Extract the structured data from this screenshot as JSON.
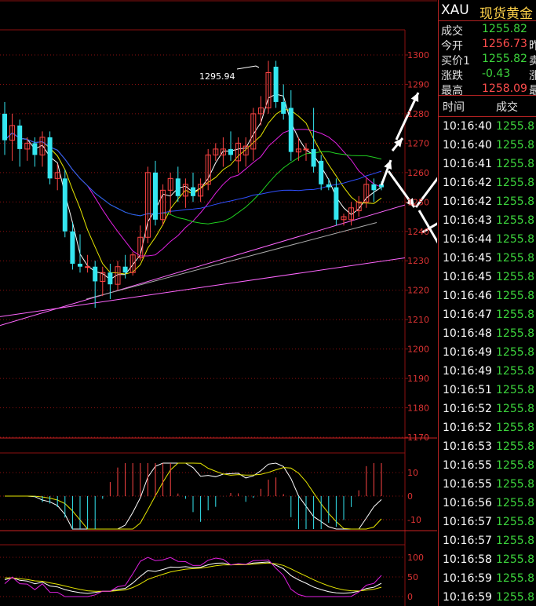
{
  "chart": {
    "peak_label": "1295.94",
    "price_axis": [
      "1300",
      "1290",
      "1280",
      "1270",
      "1260",
      "1250",
      "1240",
      "1230",
      "1220",
      "1210",
      "1200",
      "1190",
      "1180",
      "1170"
    ],
    "macd_axis": [
      "10",
      "0",
      "-10"
    ],
    "kdj_axis": [
      "100",
      "50",
      "0"
    ],
    "colors": {
      "up": "#ff4444",
      "down": "#34e6f0",
      "ma_white": "#ffffff",
      "ma_yellow": "#e6e600",
      "ma_magenta": "#e020e0",
      "ma_green": "#20d020",
      "ma_blue": "#3050ff",
      "trend": "#ff66ff",
      "grid": "#8b1010"
    }
  },
  "chart_data": {
    "type": "candlestick",
    "ylim": [
      1170,
      1305
    ],
    "candles": [
      {
        "o": 1280,
        "h": 1284,
        "l": 1266,
        "c": 1271
      },
      {
        "o": 1271,
        "h": 1280,
        "l": 1264,
        "c": 1276
      },
      {
        "o": 1276,
        "h": 1278,
        "l": 1262,
        "c": 1268
      },
      {
        "o": 1268,
        "h": 1272,
        "l": 1264,
        "c": 1270
      },
      {
        "o": 1270,
        "h": 1272,
        "l": 1262,
        "c": 1266
      },
      {
        "o": 1266,
        "h": 1274,
        "l": 1262,
        "c": 1272
      },
      {
        "o": 1272,
        "h": 1274,
        "l": 1256,
        "c": 1258
      },
      {
        "o": 1258,
        "h": 1263,
        "l": 1254,
        "c": 1260
      },
      {
        "o": 1258,
        "h": 1261,
        "l": 1238,
        "c": 1240
      },
      {
        "o": 1240,
        "h": 1243,
        "l": 1227,
        "c": 1229
      },
      {
        "o": 1229,
        "h": 1239,
        "l": 1226,
        "c": 1228
      },
      {
        "o": 1228,
        "h": 1232,
        "l": 1226,
        "c": 1228
      },
      {
        "o": 1228,
        "h": 1230,
        "l": 1214,
        "c": 1223
      },
      {
        "o": 1223,
        "h": 1228,
        "l": 1218,
        "c": 1226
      },
      {
        "o": 1226,
        "h": 1229,
        "l": 1217,
        "c": 1222
      },
      {
        "o": 1222,
        "h": 1230,
        "l": 1220,
        "c": 1228
      },
      {
        "o": 1228,
        "h": 1232,
        "l": 1224,
        "c": 1226
      },
      {
        "o": 1226,
        "h": 1233,
        "l": 1225,
        "c": 1232
      },
      {
        "o": 1231,
        "h": 1242,
        "l": 1230,
        "c": 1238
      },
      {
        "o": 1238,
        "h": 1262,
        "l": 1236,
        "c": 1260
      },
      {
        "o": 1260,
        "h": 1264,
        "l": 1242,
        "c": 1244
      },
      {
        "o": 1244,
        "h": 1256,
        "l": 1242,
        "c": 1254
      },
      {
        "o": 1254,
        "h": 1260,
        "l": 1246,
        "c": 1258
      },
      {
        "o": 1258,
        "h": 1262,
        "l": 1250,
        "c": 1252
      },
      {
        "o": 1252,
        "h": 1258,
        "l": 1248,
        "c": 1256
      },
      {
        "o": 1255,
        "h": 1260,
        "l": 1250,
        "c": 1252
      },
      {
        "o": 1252,
        "h": 1258,
        "l": 1250,
        "c": 1256
      },
      {
        "o": 1256,
        "h": 1268,
        "l": 1254,
        "c": 1266
      },
      {
        "o": 1266,
        "h": 1270,
        "l": 1264,
        "c": 1268
      },
      {
        "o": 1266,
        "h": 1272,
        "l": 1262,
        "c": 1268
      },
      {
        "o": 1268,
        "h": 1274,
        "l": 1264,
        "c": 1266
      },
      {
        "o": 1264,
        "h": 1272,
        "l": 1260,
        "c": 1270
      },
      {
        "o": 1266,
        "h": 1272,
        "l": 1262,
        "c": 1269
      },
      {
        "o": 1268,
        "h": 1282,
        "l": 1264,
        "c": 1280
      },
      {
        "o": 1280,
        "h": 1286,
        "l": 1276,
        "c": 1282
      },
      {
        "o": 1282,
        "h": 1298,
        "l": 1280,
        "c": 1294
      },
      {
        "o": 1296,
        "h": 1298,
        "l": 1282,
        "c": 1284
      },
      {
        "o": 1284,
        "h": 1290,
        "l": 1278,
        "c": 1280
      },
      {
        "o": 1282,
        "h": 1288,
        "l": 1264,
        "c": 1267
      },
      {
        "o": 1267,
        "h": 1272,
        "l": 1264,
        "c": 1268
      },
      {
        "o": 1268,
        "h": 1270,
        "l": 1264,
        "c": 1268
      },
      {
        "o": 1268,
        "h": 1282,
        "l": 1260,
        "c": 1262
      },
      {
        "o": 1264,
        "h": 1266,
        "l": 1254,
        "c": 1256
      },
      {
        "o": 1256,
        "h": 1258,
        "l": 1254,
        "c": 1255
      },
      {
        "o": 1255,
        "h": 1258,
        "l": 1242,
        "c": 1244
      },
      {
        "o": 1244,
        "h": 1246,
        "l": 1242,
        "c": 1245
      },
      {
        "o": 1244,
        "h": 1250,
        "l": 1242,
        "c": 1248
      },
      {
        "o": 1247,
        "h": 1252,
        "l": 1245,
        "c": 1250
      },
      {
        "o": 1250,
        "h": 1258,
        "l": 1248,
        "c": 1256
      },
      {
        "o": 1256,
        "h": 1258,
        "l": 1250,
        "c": 1254
      },
      {
        "o": 1256,
        "h": 1257,
        "l": 1254,
        "c": 1255
      }
    ]
  },
  "quote": {
    "symbol": "XAU",
    "name": "现货黄金",
    "rows": [
      {
        "label": "成交",
        "value": "1255.82",
        "color": "green",
        "extra": ""
      },
      {
        "label": "今开",
        "value": "1256.73",
        "color": "red",
        "extra": "昨"
      },
      {
        "label": "买价1",
        "value": "1255.82",
        "color": "green",
        "extra": "卖"
      },
      {
        "label": "涨跌",
        "value": "-0.43",
        "color": "green",
        "extra": "涨"
      },
      {
        "label": "最高",
        "value": "1258.09",
        "color": "red",
        "extra": "最"
      }
    ]
  },
  "ticks": {
    "time_header": "时间",
    "vol_header": "成交",
    "rows": [
      {
        "time": "10:16:40",
        "price": "1255.8"
      },
      {
        "time": "10:16:40",
        "price": "1255.8"
      },
      {
        "time": "10:16:41",
        "price": "1255.8"
      },
      {
        "time": "10:16:42",
        "price": "1255.8"
      },
      {
        "time": "10:16:42",
        "price": "1255.8"
      },
      {
        "time": "10:16:43",
        "price": "1255.8"
      },
      {
        "time": "10:16:44",
        "price": "1255.8"
      },
      {
        "time": "10:16:45",
        "price": "1255.8"
      },
      {
        "time": "10:16:45",
        "price": "1255.8"
      },
      {
        "time": "10:16:46",
        "price": "1255.8"
      },
      {
        "time": "10:16:47",
        "price": "1255.8"
      },
      {
        "time": "10:16:48",
        "price": "1255.8"
      },
      {
        "time": "10:16:49",
        "price": "1255.8"
      },
      {
        "time": "10:16:49",
        "price": "1255.8"
      },
      {
        "time": "10:16:51",
        "price": "1255.8"
      },
      {
        "time": "10:16:52",
        "price": "1255.8"
      },
      {
        "time": "10:16:52",
        "price": "1255.8"
      },
      {
        "time": "10:16:53",
        "price": "1255.8"
      },
      {
        "time": "10:16:55",
        "price": "1255.8"
      },
      {
        "time": "10:16:55",
        "price": "1255.8"
      },
      {
        "time": "10:16:56",
        "price": "1255.8"
      },
      {
        "time": "10:16:57",
        "price": "1255.8"
      },
      {
        "time": "10:16:57",
        "price": "1255.8"
      },
      {
        "time": "10:16:58",
        "price": "1255.8"
      },
      {
        "time": "10:16:59",
        "price": "1255.8"
      },
      {
        "time": "10:16:59",
        "price": "1255.8"
      }
    ]
  }
}
